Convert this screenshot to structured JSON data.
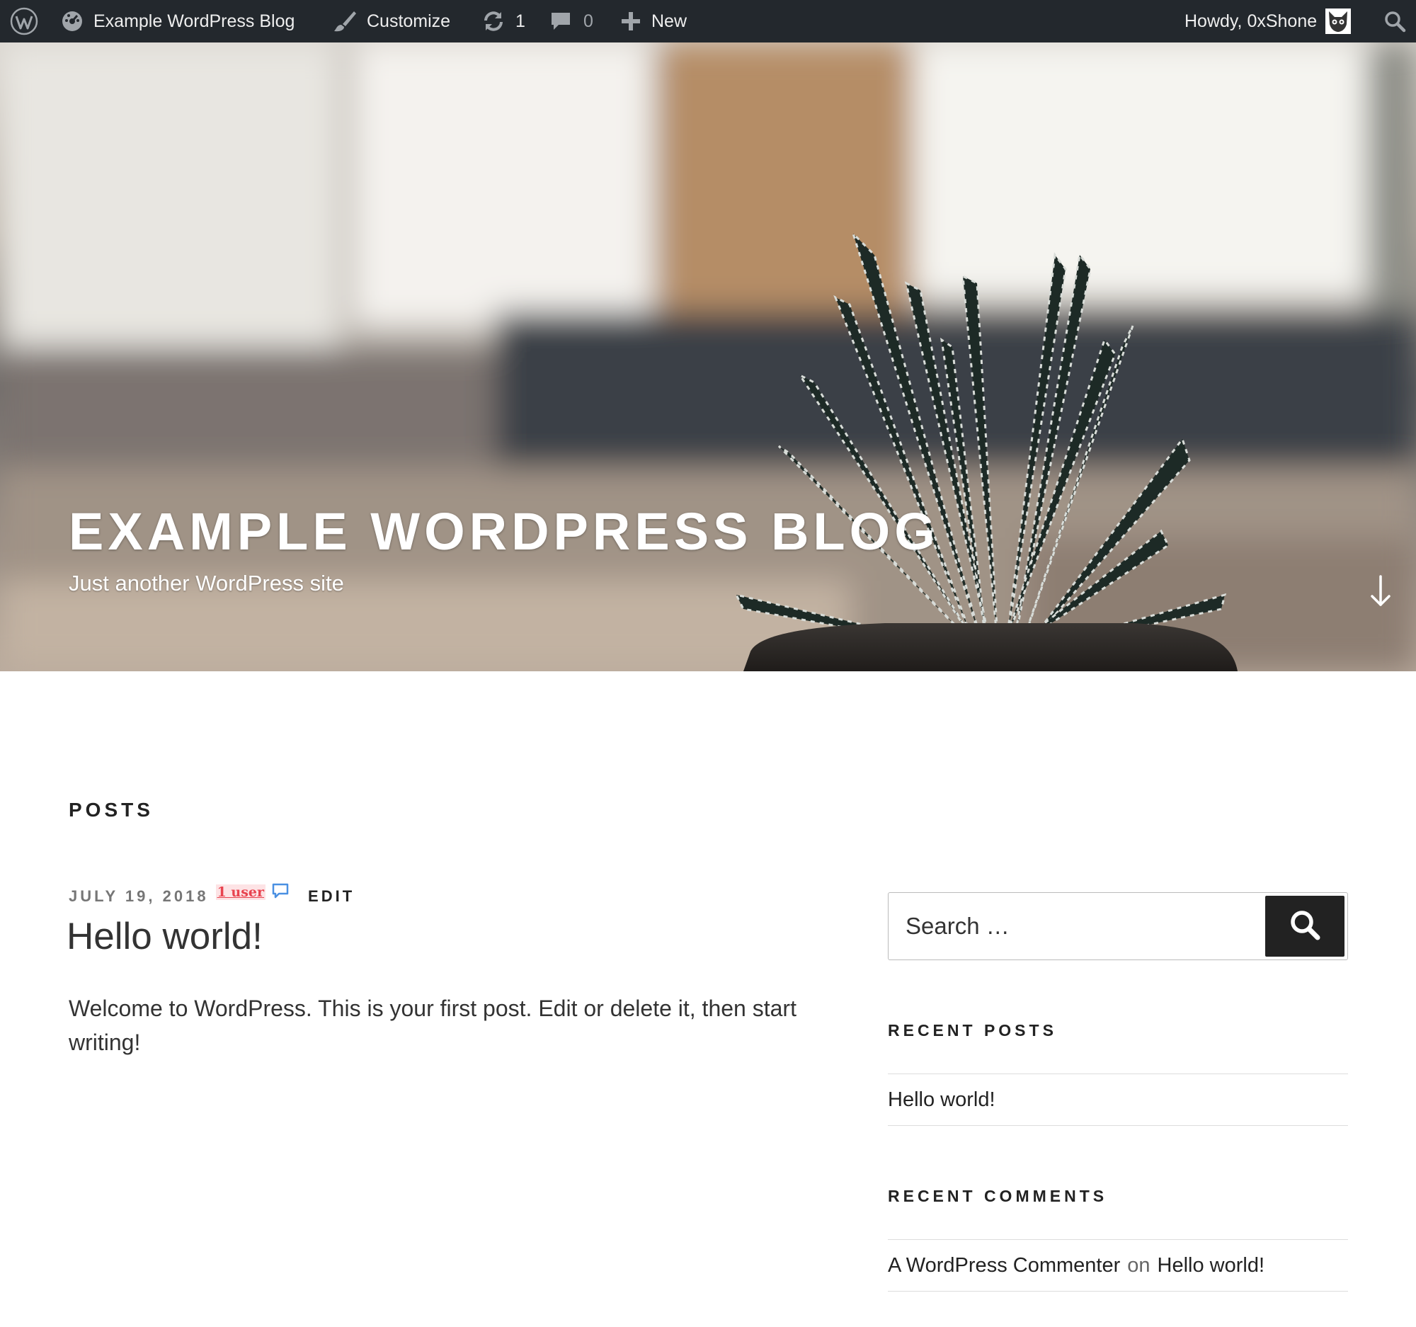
{
  "adminbar": {
    "wp_logo_icon": "wordpress-logo-icon",
    "site_name": "Example WordPress Blog",
    "customize": "Customize",
    "updates_count": "1",
    "comments_count": "0",
    "new_label": "New",
    "howdy": "Howdy, 0xShone",
    "colors": {
      "background": "#23282d",
      "text": "#eeeeee",
      "muted": "#a0a5aa"
    }
  },
  "header": {
    "site_title": "EXAMPLE WORDPRESS BLOG",
    "site_description": "Just another WordPress site",
    "scroll_icon": "arrow-down-icon"
  },
  "main": {
    "page_heading": "POSTS",
    "post": {
      "date": "JULY 19, 2018",
      "users_badge": "1 user",
      "edit_label": "EDIT",
      "title": "Hello world!",
      "excerpt": "Welcome to WordPress. This is your first post. Edit or delete it, then start writing!"
    }
  },
  "sidebar": {
    "search": {
      "placeholder": "Search …",
      "button_icon": "search-icon"
    },
    "recent_posts": {
      "title": "RECENT POSTS",
      "items": [
        "Hello world!"
      ]
    },
    "recent_comments": {
      "title": "RECENT COMMENTS",
      "items": [
        {
          "author": "A WordPress Commenter",
          "connector": "on",
          "post": "Hello world!"
        }
      ]
    }
  }
}
